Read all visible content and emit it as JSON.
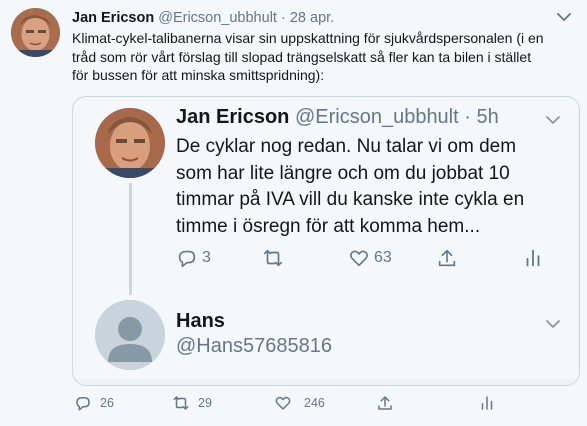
{
  "tweet": {
    "author_name": "Jan Ericson",
    "author_handle": "@Ericson_ubbhult",
    "separator": " · ",
    "date": "28 apr.",
    "text_lines": [
      "Klimat-cykel-talibanerna visar sin uppskattning för sjukvårdspersonalen (i en",
      "tråd som rör vårt förslag till slopad trängselskatt så fler kan ta bilen i stället",
      "för bussen för att minska smittspridning):"
    ],
    "actions": {
      "replies": "26",
      "retweets": "29",
      "likes": "246"
    }
  },
  "quote": {
    "author_name": "Jan Ericson",
    "author_handle": "@Ericson_ubbhult",
    "separator": " · ",
    "time": "5h",
    "text_lines": [
      "De cyklar nog redan. Nu talar vi om dem",
      "som har lite längre och om du jobbat 10",
      "timmar på IVA vill du kanske inte cykla en",
      "timme i ösregn för att komma hem..."
    ],
    "actions": {
      "replies": "3",
      "retweets": "",
      "likes": "63"
    },
    "reply": {
      "name": "Hans",
      "handle": "@Hans57685816"
    }
  },
  "icons": {
    "reply": "reply-icon",
    "retweet": "retweet-icon",
    "like": "heart-icon",
    "share": "share-icon",
    "analytics": "analytics-icon",
    "more": "chevron-down-icon"
  },
  "colors": {
    "background": "#f5f8fa",
    "text": "#14171a",
    "muted": "#657786",
    "border": "#ccd6dd"
  }
}
